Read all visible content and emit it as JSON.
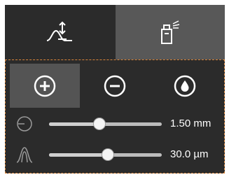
{
  "tabs": [
    {
      "icon": "peak-arrows-icon",
      "active": true
    },
    {
      "icon": "spray-bottle-icon",
      "active": false
    }
  ],
  "tools": [
    {
      "icon": "plus-circle-icon",
      "active": true
    },
    {
      "icon": "minus-circle-icon",
      "active": false
    },
    {
      "icon": "drop-circle-icon",
      "active": false
    }
  ],
  "sliders": [
    {
      "icon": "radius-circle-icon",
      "value": 0.45,
      "label": "1.50 mm"
    },
    {
      "icon": "bell-curve-icon",
      "value": 0.52,
      "label": "30.0 µm"
    }
  ],
  "colors": {
    "accent_dashed": "#d9843a",
    "panel_bg": "#2b2b2b",
    "active_tab": "#585858",
    "active_tool": "#545454"
  }
}
